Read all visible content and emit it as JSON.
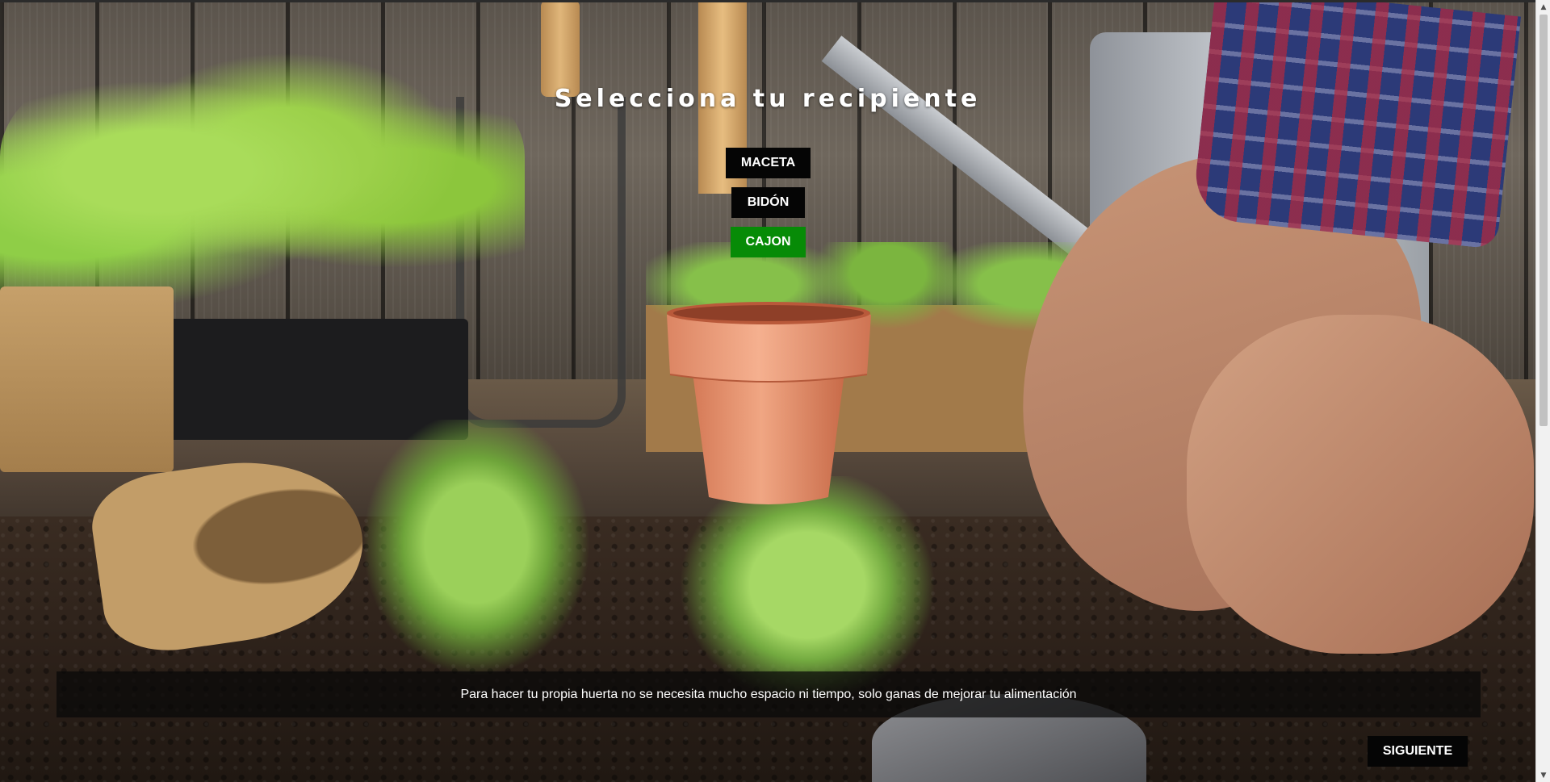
{
  "page": {
    "title": "Selecciona tu recipiente"
  },
  "containers": [
    {
      "label": "MACETA",
      "selected": false
    },
    {
      "label": "BIDÓN",
      "selected": false
    },
    {
      "label": "CAJON",
      "selected": true
    }
  ],
  "preview": {
    "icon": "terracotta-pot"
  },
  "info": {
    "text": "Para hacer tu propia huerta no se necesita mucho espacio ni tiempo, solo ganas de mejorar tu alimentación"
  },
  "navigation": {
    "next_label": "SIGUIENTE"
  },
  "colors": {
    "button_bg": "#050505",
    "selected_bg": "#078b07",
    "text": "#ffffff"
  },
  "scrollbar": {
    "up_icon": "▲",
    "down_icon": "▼"
  }
}
